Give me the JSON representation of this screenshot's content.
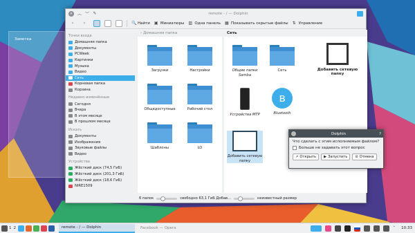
{
  "desktop": {
    "panel_label": "Заметка"
  },
  "window": {
    "title": "remote - / — Dolphin",
    "toolbar": {
      "find": "Найти",
      "preview": "Миниатюры",
      "split": "Одна панель",
      "hidden": "Показывать скрытые файлы",
      "control": "Управление"
    },
    "places": {
      "section_entry": "Точки входа",
      "entry": [
        "Домашняя папка",
        "Документы",
        "PCWeek",
        "Картинки",
        "Музыка",
        "Видео",
        "Сеть",
        "Корневая папка",
        "Корзина"
      ],
      "section_recent": "Недавно изменённые",
      "recent": [
        "Сегодня",
        "Вчера",
        "В этом месяце",
        "В прошлом месяце"
      ],
      "section_search": "Искать",
      "search": [
        "Документы",
        "Изображения",
        "Звуковые файлы",
        "Видео"
      ],
      "section_devices": "Устройства",
      "devices": [
        "Жёсткий диск (74,5 ГиБ)",
        "Жёсткий диск (201,3 ГиБ)",
        "Жёсткий диск (18,6 ГиБ)",
        "NIRE1509"
      ]
    },
    "left_pane": {
      "crumb": "Домашняя папка",
      "items": [
        "Загрузки",
        "Настройки",
        "Общедоступные",
        "Рабочий стол",
        "Шаблоны",
        "LO"
      ]
    },
    "right_pane": {
      "crumb": "Сеть",
      "items": [
        "Общие папки Samba",
        "Сеть",
        "Устройства MTP",
        "Bluetooth",
        "Добавить сетевую папку"
      ]
    },
    "side_action": "Добавить сетевую папку",
    "status": {
      "count": "6 папок",
      "free": "свободно 63,1 ГиБ Добав...",
      "right": "неизвестный размер"
    }
  },
  "dialog": {
    "title": "Dolphin",
    "question": "Что сделать с этим исполняемым файлом?",
    "dont_ask": "Больше не задавать этот вопрос",
    "open": "Открыть",
    "run": "Запустить",
    "cancel": "Отмена"
  },
  "taskbar": {
    "desk": "1",
    "desk2": "2",
    "task_active": "remote - / — Dolphin",
    "task_other": "Facebook — Opera",
    "clock": "10:33"
  }
}
